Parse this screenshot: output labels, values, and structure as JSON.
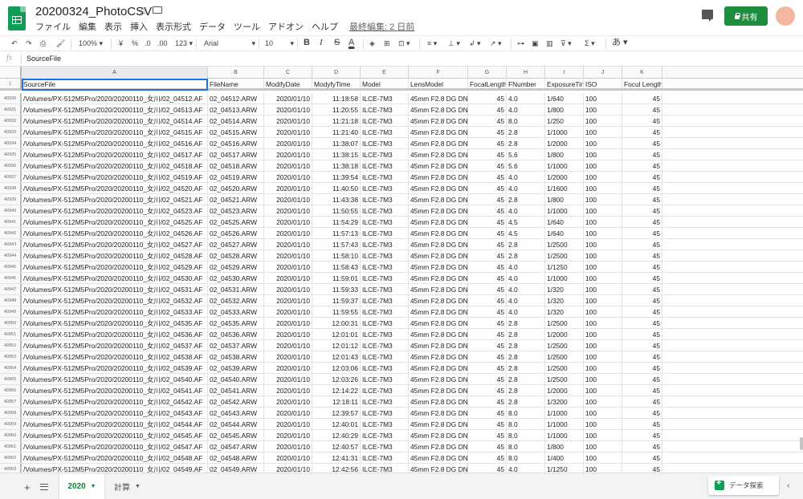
{
  "app": {
    "doc_title": "20200324_PhotoCSV",
    "menus": [
      "ファイル",
      "編集",
      "表示",
      "挿入",
      "表示形式",
      "データ",
      "ツール",
      "アドオン",
      "ヘルプ"
    ],
    "last_edit": "最終編集: 2 日前",
    "share_label": "共有"
  },
  "toolbar": {
    "zoom": "100%",
    "currency": "¥",
    "percent": "%",
    "decimal_less": ".0",
    "decimal_more": ".00",
    "format_more": "123",
    "font": "Arial",
    "font_size": "10",
    "bold": "B",
    "italic": "I",
    "strike": "S",
    "text_color": "A",
    "input_tools": "あ"
  },
  "formula": {
    "fx": "fx",
    "value": "SourceFile"
  },
  "columns": [
    "A",
    "B",
    "C",
    "D",
    "E",
    "F",
    "G",
    "H",
    "I",
    "J",
    "K"
  ],
  "header_row": {
    "num": "1",
    "cells": [
      "SourceFile",
      "FileName",
      "ModifyDate",
      "ModyfyTime",
      "Model",
      "LensModel",
      "FocalLength",
      "FNumber",
      "ExposureTime",
      "ISO",
      "Focul Length"
    ]
  },
  "rows": [
    {
      "num": "40930",
      "file": "02_04512.ARW",
      "date": "2020/01/10",
      "time": "11:18:58",
      "fnum": "4.0",
      "exp": "1/640",
      "iso": "100"
    },
    {
      "num": "40931",
      "file": "02_04513.ARW",
      "date": "2020/01/10",
      "time": "11:20:55",
      "fnum": "4.0",
      "exp": "1/800",
      "iso": "100"
    },
    {
      "num": "40932",
      "file": "02_04514.ARW",
      "date": "2020/01/10",
      "time": "11:21:18",
      "fnum": "8.0",
      "exp": "1/250",
      "iso": "100"
    },
    {
      "num": "40933",
      "file": "02_04515.ARW",
      "date": "2020/01/10",
      "time": "11:21:40",
      "fnum": "2.8",
      "exp": "1/1000",
      "iso": "100"
    },
    {
      "num": "40934",
      "file": "02_04516.ARW",
      "date": "2020/01/10",
      "time": "11:38:07",
      "fnum": "2.8",
      "exp": "1/2000",
      "iso": "100"
    },
    {
      "num": "40935",
      "file": "02_04517.ARW",
      "date": "2020/01/10",
      "time": "11:38:15",
      "fnum": "5.6",
      "exp": "1/800",
      "iso": "100"
    },
    {
      "num": "40936",
      "file": "02_04518.ARW",
      "date": "2020/01/10",
      "time": "11:38:18",
      "fnum": "5.6",
      "exp": "1/1000",
      "iso": "100"
    },
    {
      "num": "40937",
      "file": "02_04519.ARW",
      "date": "2020/01/10",
      "time": "11:39:54",
      "fnum": "4.0",
      "exp": "1/2000",
      "iso": "100"
    },
    {
      "num": "40938",
      "file": "02_04520.ARW",
      "date": "2020/01/10",
      "time": "11:40:50",
      "fnum": "4.0",
      "exp": "1/1600",
      "iso": "100"
    },
    {
      "num": "40939",
      "file": "02_04521.ARW",
      "date": "2020/01/10",
      "time": "11:43:38",
      "fnum": "2.8",
      "exp": "1/800",
      "iso": "100"
    },
    {
      "num": "40940",
      "file": "02_04523.ARW",
      "date": "2020/01/10",
      "time": "11:50:55",
      "fnum": "4.0",
      "exp": "1/1000",
      "iso": "100"
    },
    {
      "num": "40941",
      "file": "02_04525.ARW",
      "date": "2020/01/10",
      "time": "11:54:29",
      "fnum": "4.5",
      "exp": "1/640",
      "iso": "100"
    },
    {
      "num": "40942",
      "file": "02_04526.ARW",
      "date": "2020/01/10",
      "time": "11:57:13",
      "fnum": "4.5",
      "exp": "1/640",
      "iso": "100"
    },
    {
      "num": "40943",
      "file": "02_04527.ARW",
      "date": "2020/01/10",
      "time": "11:57:43",
      "fnum": "2.8",
      "exp": "1/2500",
      "iso": "100"
    },
    {
      "num": "40944",
      "file": "02_04528.ARW",
      "date": "2020/01/10",
      "time": "11:58:10",
      "fnum": "2.8",
      "exp": "1/2500",
      "iso": "100"
    },
    {
      "num": "40945",
      "file": "02_04529.ARW",
      "date": "2020/01/10",
      "time": "11:58:43",
      "fnum": "4.0",
      "exp": "1/1250",
      "iso": "100"
    },
    {
      "num": "40946",
      "file": "02_04530.ARW",
      "date": "2020/01/10",
      "time": "11:59:01",
      "fnum": "4.0",
      "exp": "1/1000",
      "iso": "100"
    },
    {
      "num": "40947",
      "file": "02_04531.ARW",
      "date": "2020/01/10",
      "time": "11:59:33",
      "fnum": "4.0",
      "exp": "1/320",
      "iso": "100"
    },
    {
      "num": "40948",
      "file": "02_04532.ARW",
      "date": "2020/01/10",
      "time": "11:59:37",
      "fnum": "4.0",
      "exp": "1/320",
      "iso": "100"
    },
    {
      "num": "40949",
      "file": "02_04533.ARW",
      "date": "2020/01/10",
      "time": "11:59:55",
      "fnum": "4.0",
      "exp": "1/320",
      "iso": "100"
    },
    {
      "num": "40950",
      "file": "02_04535.ARW",
      "date": "2020/01/10",
      "time": "12:00:31",
      "fnum": "2.8",
      "exp": "1/2500",
      "iso": "100"
    },
    {
      "num": "40951",
      "file": "02_04536.ARW",
      "date": "2020/01/10",
      "time": "12:01:01",
      "fnum": "2.8",
      "exp": "1/2000",
      "iso": "100"
    },
    {
      "num": "40952",
      "file": "02_04537.ARW",
      "date": "2020/01/10",
      "time": "12:01:12",
      "fnum": "2.8",
      "exp": "1/2500",
      "iso": "100"
    },
    {
      "num": "40953",
      "file": "02_04538.ARW",
      "date": "2020/01/10",
      "time": "12:01:43",
      "fnum": "2.8",
      "exp": "1/2500",
      "iso": "100"
    },
    {
      "num": "40954",
      "file": "02_04539.ARW",
      "date": "2020/01/10",
      "time": "12:03:06",
      "fnum": "2.8",
      "exp": "1/2500",
      "iso": "100"
    },
    {
      "num": "40955",
      "file": "02_04540.ARW",
      "date": "2020/01/10",
      "time": "12:03:26",
      "fnum": "2.8",
      "exp": "1/2500",
      "iso": "100"
    },
    {
      "num": "40956",
      "file": "02_04541.ARW",
      "date": "2020/01/10",
      "time": "12:14:22",
      "fnum": "2.8",
      "exp": "1/2000",
      "iso": "100"
    },
    {
      "num": "40957",
      "file": "02_04542.ARW",
      "date": "2020/01/10",
      "time": "12:18:11",
      "fnum": "2.8",
      "exp": "1/3200",
      "iso": "100"
    },
    {
      "num": "40958",
      "file": "02_04543.ARW",
      "date": "2020/01/10",
      "time": "12:39:57",
      "fnum": "8.0",
      "exp": "1/1000",
      "iso": "100"
    },
    {
      "num": "40959",
      "file": "02_04544.ARW",
      "date": "2020/01/10",
      "time": "12:40:01",
      "fnum": "8.0",
      "exp": "1/1000",
      "iso": "100"
    },
    {
      "num": "40960",
      "file": "02_04545.ARW",
      "date": "2020/01/10",
      "time": "12:40:29",
      "fnum": "8.0",
      "exp": "1/1000",
      "iso": "100"
    },
    {
      "num": "40961",
      "file": "02_04547.ARW",
      "date": "2020/01/10",
      "time": "12:40:57",
      "fnum": "8.0",
      "exp": "1/800",
      "iso": "100"
    },
    {
      "num": "40962",
      "file": "02_04548.ARW",
      "date": "2020/01/10",
      "time": "12:41:31",
      "fnum": "8.0",
      "exp": "1/400",
      "iso": "100"
    },
    {
      "num": "40963",
      "file": "02_04549.ARW",
      "date": "2020/01/10",
      "time": "12:42:56",
      "fnum": "4.0",
      "exp": "1/1250",
      "iso": "100"
    }
  ],
  "row_common": {
    "source_prefix": "/Volumes/PX-512M5Pro/2020/20200110_女川/",
    "source_tail": "02_045",
    "source_suffix": ".AF",
    "model": "ILCE-7M3",
    "lens": "45mm F2.8 DG DN",
    "focal": "45",
    "focul": "45"
  },
  "sheets": {
    "active": "2020",
    "other": "計算"
  },
  "explore_label": "データ探索",
  "colors": {
    "brand_green": "#0f9d58",
    "share_green": "#1e8e3e",
    "selection_blue": "#1a73e8"
  }
}
